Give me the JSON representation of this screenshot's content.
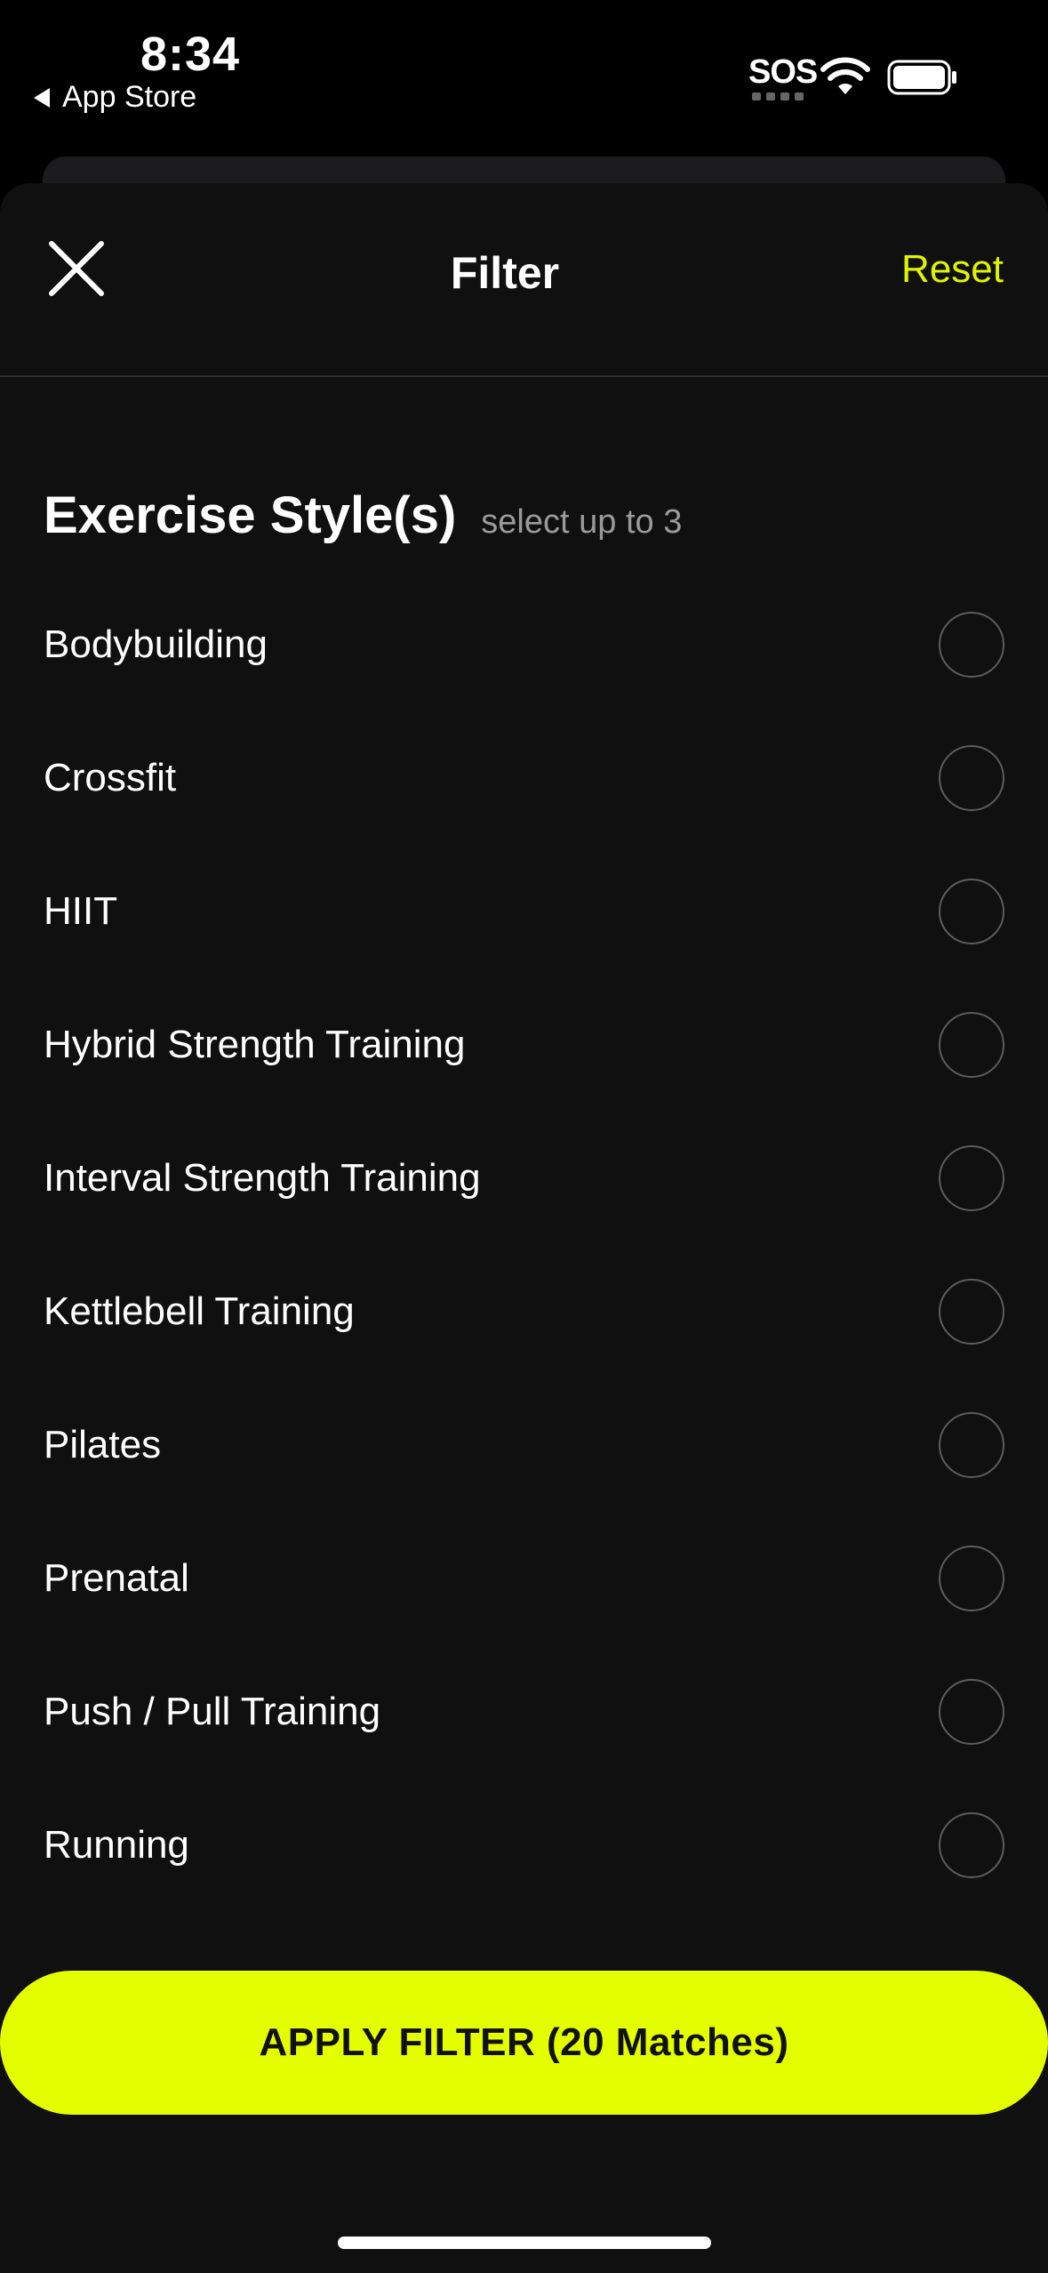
{
  "status_bar": {
    "time": "8:34",
    "back_label": "App Store",
    "sos": "SOS"
  },
  "header": {
    "title": "Filter",
    "reset_label": "Reset",
    "close_icon": "close-icon"
  },
  "section": {
    "title": "Exercise Style(s)",
    "subtitle": "select up to 3"
  },
  "options": [
    {
      "label": "Bodybuilding",
      "selected": false
    },
    {
      "label": "Crossfit",
      "selected": false
    },
    {
      "label": "HIIT",
      "selected": false
    },
    {
      "label": "Hybrid Strength Training",
      "selected": false
    },
    {
      "label": "Interval Strength Training",
      "selected": false
    },
    {
      "label": "Kettlebell Training",
      "selected": false
    },
    {
      "label": "Pilates",
      "selected": false
    },
    {
      "label": "Prenatal",
      "selected": false
    },
    {
      "label": "Push / Pull Training",
      "selected": false
    },
    {
      "label": "Running",
      "selected": false
    }
  ],
  "apply_button": {
    "label": "APPLY FILTER (20 Matches)"
  },
  "colors": {
    "accent": "#e4ff00",
    "reset_text": "#dff400",
    "sheet_bg": "#101010"
  }
}
